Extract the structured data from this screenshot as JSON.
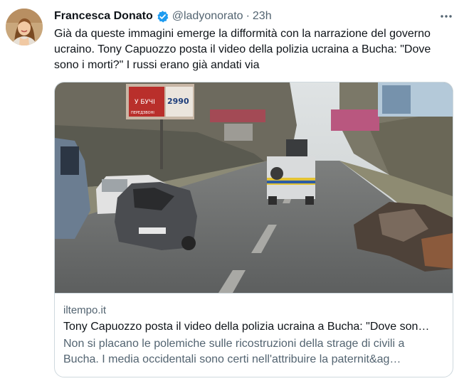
{
  "author": {
    "name": "Francesca Donato",
    "handle": "@ladyonorato",
    "separator": "·",
    "time": "23h",
    "verified": true
  },
  "tweet": {
    "text": "Già da queste immagini emerge la difformità con la narrazione del governo ucraino. Tony Capuozzo posta il video della polizia ucraina a Bucha: \"Dove sono i morti?\" I russi erano già andati via"
  },
  "card": {
    "domain": "iltempo.it",
    "title": "Tony Capuozzo posta il video della polizia ucraina a Bucha: \"Dove son…",
    "description_line1": "Non si placano le polemiche sulle ricostruzioni della strage di civili a",
    "description_line2": "Bucha. I media occidentali sono certi nell'attribuire la paternit&ag…"
  },
  "image": {
    "billboard_left_line1": "У БУЧІ",
    "billboard_left_price": "2990",
    "billboard_left_line2": "ПЕРЕДЗВОНІ"
  },
  "icons": {
    "more": "more-horizontal-icon",
    "verified": "verified-badge-icon"
  },
  "colors": {
    "verified": "#1d9bf0",
    "secondary_text": "#536471",
    "border": "#cfd9de"
  }
}
